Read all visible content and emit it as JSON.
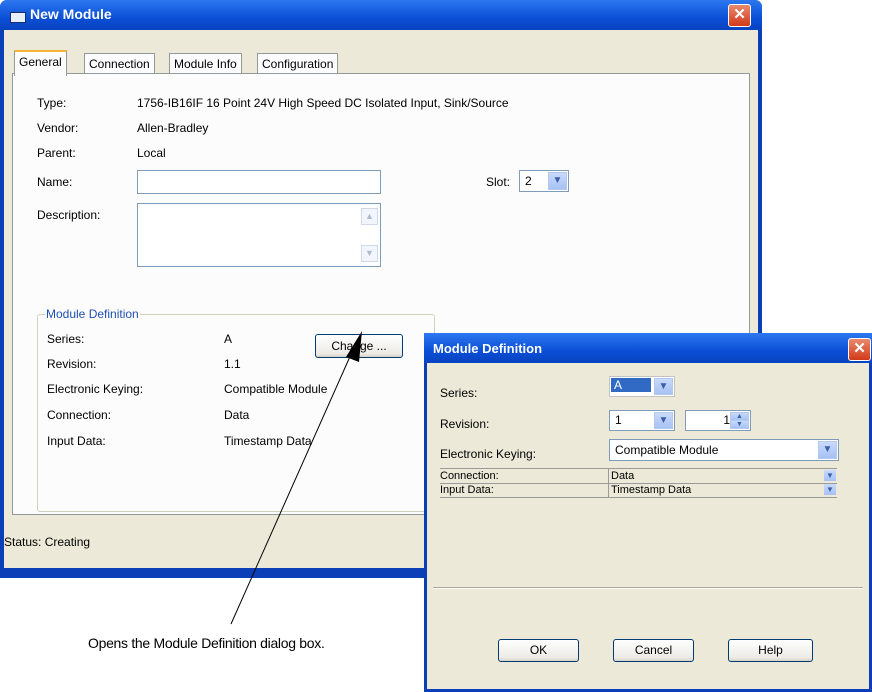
{
  "main_window": {
    "title": "New Module",
    "tabs": [
      "General",
      "Connection",
      "Module Info",
      "Configuration"
    ],
    "general": {
      "type_label": "Type:",
      "type_value": "1756-IB16IF 16 Point 24V High Speed DC Isolated Input, Sink/Source",
      "vendor_label": "Vendor:",
      "vendor_value": "Allen-Bradley",
      "parent_label": "Parent:",
      "parent_value": "Local",
      "name_label": "Name:",
      "name_value": "",
      "slot_label": "Slot:",
      "slot_value": "2",
      "description_label": "Description:",
      "description_value": ""
    },
    "module_definition": {
      "legend": "Module Definition",
      "rows": [
        {
          "label": "Series:",
          "value": "A"
        },
        {
          "label": "Revision:",
          "value": "1.1"
        },
        {
          "label": "Electronic Keying:",
          "value": "Compatible Module"
        },
        {
          "label": "Connection:",
          "value": "Data"
        },
        {
          "label": "Input Data:",
          "value": "Timestamp Data"
        }
      ],
      "change_button": "Change ..."
    },
    "status_label": "Status:",
    "status_value": "Creating"
  },
  "md_dialog": {
    "title": "Module Definition",
    "series_label": "Series:",
    "series_value": "A",
    "revision_label": "Revision:",
    "revision_major": "1",
    "revision_minor": "1",
    "keying_label": "Electronic Keying:",
    "keying_value": "Compatible Module",
    "grid": [
      {
        "label": "Connection:",
        "value": "Data"
      },
      {
        "label": "Input Data:",
        "value": "Timestamp Data"
      }
    ],
    "ok_button": "OK",
    "cancel_button": "Cancel",
    "help_button": "Help"
  },
  "callout": {
    "text": "Opens the Module Definition dialog box."
  },
  "colors": {
    "titlebar": "#0a4fd6",
    "dialog_face": "#ece9d8",
    "group_legend": "#1f4fb4",
    "close_button": "#d13a19"
  },
  "icons": [
    "app-window-icon",
    "close-icon",
    "chevron-down-icon",
    "scroll-up-icon",
    "scroll-down-icon",
    "spin-up-icon",
    "spin-down-icon"
  ]
}
